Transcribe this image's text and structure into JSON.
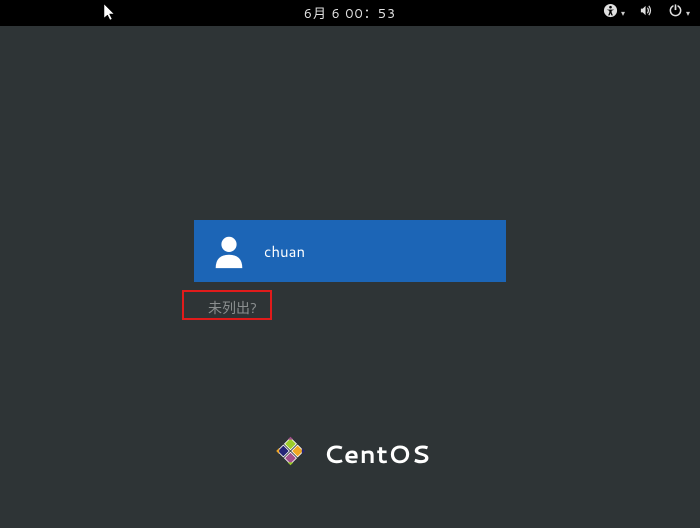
{
  "topbar": {
    "clock": "6月 6 00：53"
  },
  "login": {
    "username": "chuan",
    "not_listed_label": "未列出?"
  },
  "branding": {
    "name": "CentOS"
  }
}
